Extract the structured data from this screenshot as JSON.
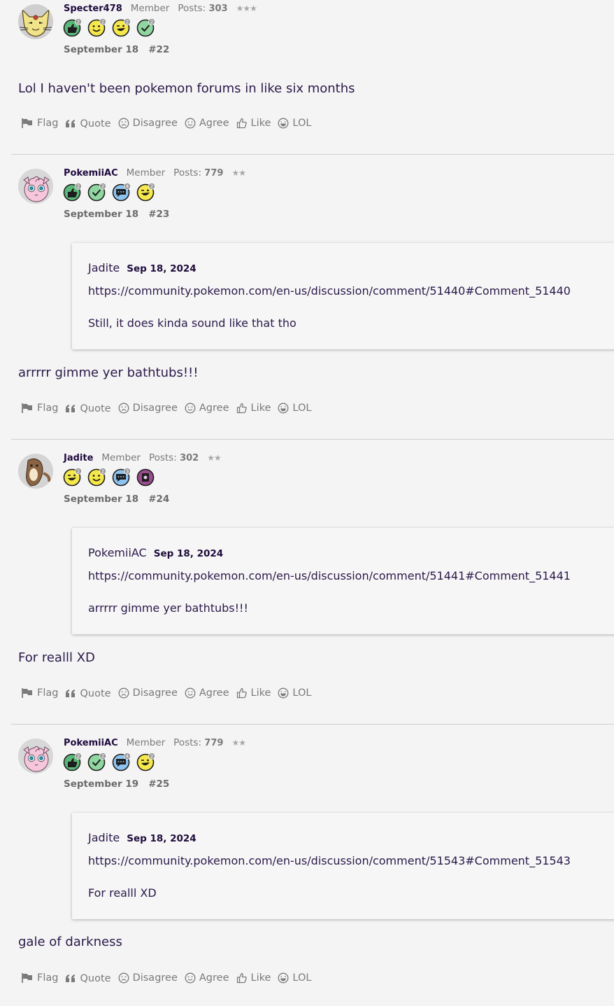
{
  "actions": {
    "flag": "Flag",
    "quote": "Quote",
    "disagree": "Disagree",
    "agree": "Agree",
    "like": "Like",
    "lol": "LOL"
  },
  "posts": [
    {
      "username": "Specter478",
      "role": "Member",
      "posts_label": "Posts:",
      "posts_count": "303",
      "stars": "★★★",
      "avatar": "persian-avatar",
      "badges": [
        {
          "icon": "thumbs-up-badge-icon",
          "count": "2"
        },
        {
          "icon": "smile-badge-icon",
          "count": "2"
        },
        {
          "icon": "wink-badge-icon",
          "count": "2"
        },
        {
          "icon": "check-badge-icon",
          "count": "2"
        }
      ],
      "date": "September 18",
      "number": "#22",
      "body": "Lol I haven't been pokemon forums in like six months"
    },
    {
      "username": "PokemiiAC",
      "role": "Member",
      "posts_label": "Posts:",
      "posts_count": "779",
      "stars": "★★",
      "avatar": "jigglypuff-avatar",
      "badges": [
        {
          "icon": "thumbs-up-badge-icon",
          "count": "2"
        },
        {
          "icon": "check-badge-icon",
          "count": "2"
        },
        {
          "icon": "comment-badge-icon",
          "count": "4"
        },
        {
          "icon": "wink-badge-icon",
          "count": "2"
        }
      ],
      "date": "September 18",
      "number": "#23",
      "quote": {
        "author": "Jadite",
        "date": "Sep 18, 2024",
        "link": "https://community.pokemon.com/en-us/discussion/comment/51440#Comment_51440",
        "text": "Still, it does kinda sound like that tho"
      },
      "body": "arrrrr gimme yer bathtubs!!!"
    },
    {
      "username": "Jadite",
      "role": "Member",
      "posts_label": "Posts:",
      "posts_count": "302",
      "stars": "★★",
      "avatar": "furret-avatar",
      "badges": [
        {
          "icon": "wink-badge-icon",
          "count": "2"
        },
        {
          "icon": "smile-badge-icon",
          "count": "2"
        },
        {
          "icon": "comment-badge-icon",
          "count": "3"
        },
        {
          "icon": "book-badge-icon",
          "count": ""
        }
      ],
      "date": "September 18",
      "number": "#24",
      "quote": {
        "author": "PokemiiAC",
        "date": "Sep 18, 2024",
        "link": "https://community.pokemon.com/en-us/discussion/comment/51441#Comment_51441",
        "text": "arrrrr gimme yer bathtubs!!!"
      },
      "body": "For realll XD"
    },
    {
      "username": "PokemiiAC",
      "role": "Member",
      "posts_label": "Posts:",
      "posts_count": "779",
      "stars": "★★",
      "avatar": "jigglypuff-avatar",
      "badges": [
        {
          "icon": "thumbs-up-badge-icon",
          "count": "2"
        },
        {
          "icon": "check-badge-icon",
          "count": "2"
        },
        {
          "icon": "comment-badge-icon",
          "count": "4"
        },
        {
          "icon": "wink-badge-icon",
          "count": "2"
        }
      ],
      "date": "September 19",
      "number": "#25",
      "quote": {
        "author": "Jadite",
        "date": "Sep 18, 2024",
        "link": "https://community.pokemon.com/en-us/discussion/comment/51543#Comment_51543",
        "text": "For realll XD"
      },
      "body": "gale of darkness"
    }
  ]
}
